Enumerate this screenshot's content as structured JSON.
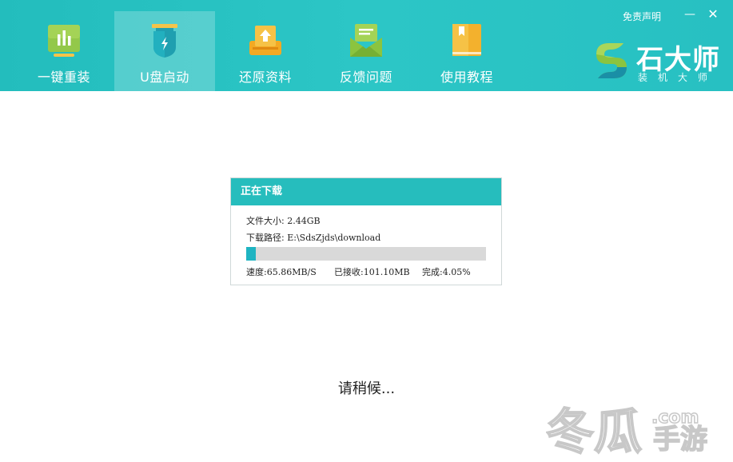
{
  "header": {
    "nav": [
      {
        "label": "一键重装",
        "icon": "chart-bars-icon"
      },
      {
        "label": "U盘启动",
        "icon": "usb-drive-icon"
      },
      {
        "label": "还原资料",
        "icon": "restore-upload-icon"
      },
      {
        "label": "反馈问题",
        "icon": "feedback-mail-icon"
      },
      {
        "label": "使用教程",
        "icon": "tutorial-book-icon"
      }
    ],
    "active_index": 1,
    "disclaimer": "免责声明",
    "minimize_symbol": "—",
    "close_symbol": "✕",
    "logo_title": "石大师",
    "logo_subtitle": "装机大师"
  },
  "dialog": {
    "title": "正在下载",
    "file_size_label": "文件大小:",
    "file_size_value": "2.44GB",
    "path_label": "下载路径:",
    "path_value": "E:\\SdsZjds\\download",
    "progress_fraction": 0.0405,
    "speed_text": "速度:65.86MB/S",
    "received_text": "已接收:101.10MB",
    "complete_text": "完成:4.05%"
  },
  "status": {
    "wait_text": "请稍候..."
  },
  "watermark": {
    "text": "冬瓜",
    "dotcom": ".com",
    "suffix": "手游"
  },
  "colors": {
    "header_bg": "#26bfc0",
    "accent": "#1fb4c2",
    "icon_green": "#8bc43f",
    "icon_orange": "#f3b12d",
    "icon_teal": "#1f9fb0"
  }
}
